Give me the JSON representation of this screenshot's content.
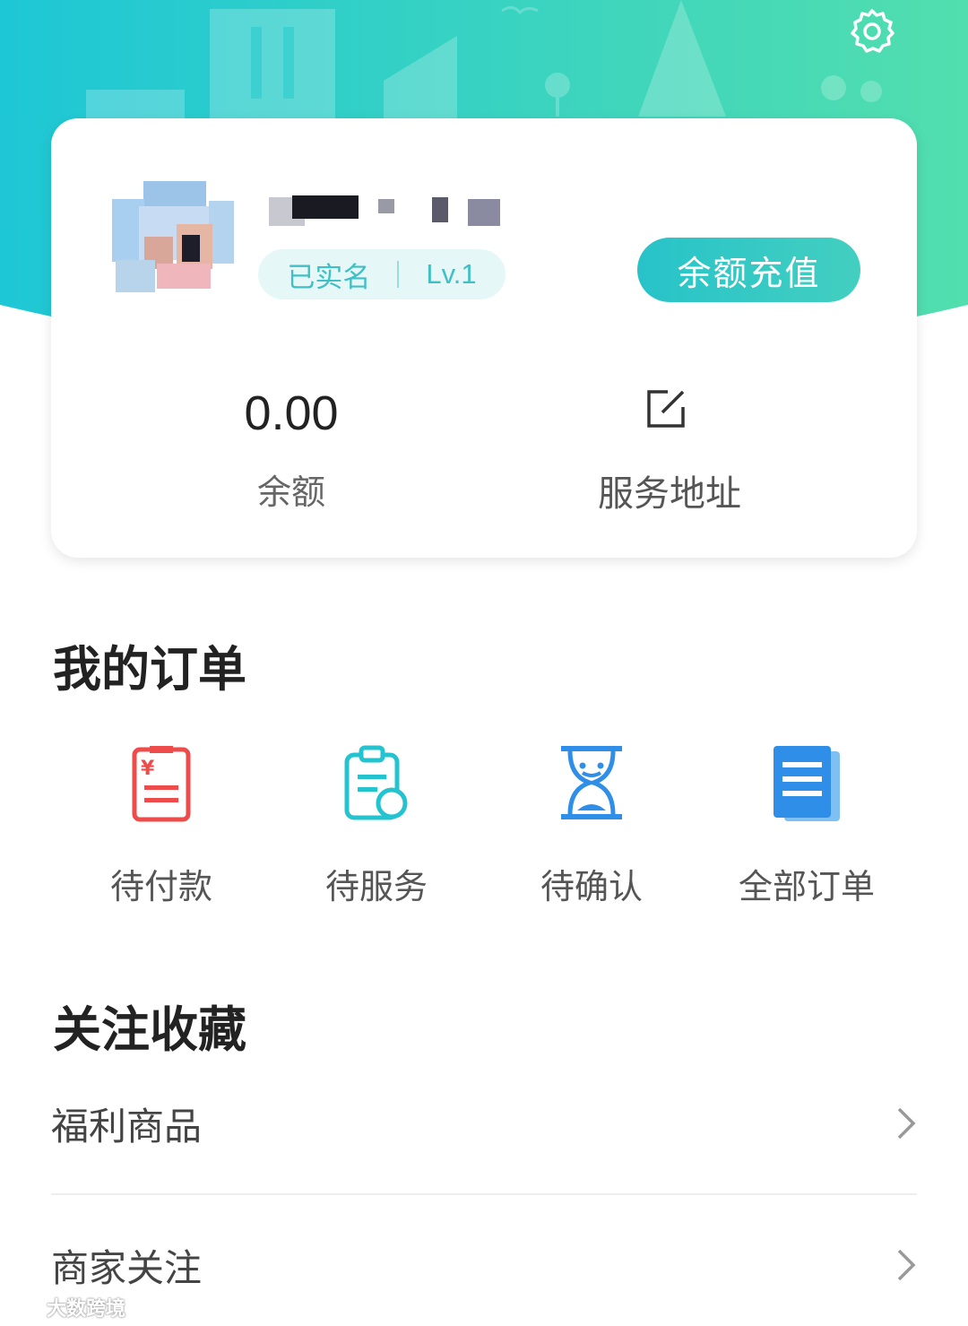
{
  "header": {
    "settings_icon": "gear-icon",
    "gradient_colors": [
      "#1ec7d6",
      "#4fdcb0"
    ]
  },
  "profile": {
    "badge_verified": "已实名",
    "badge_level": "Lv.1",
    "recharge_label": "余额充值",
    "balance_value": "0.00",
    "balance_label": "余额",
    "address_icon": "edit-square-icon",
    "address_label": "服务地址"
  },
  "orders": {
    "title": "我的订单",
    "items": [
      {
        "label": "待付款",
        "icon": "payment-bill-icon",
        "color": "#ee4b4b"
      },
      {
        "label": "待服务",
        "icon": "clipboard-icon",
        "color": "#23c3cf"
      },
      {
        "label": "待确认",
        "icon": "hourglass-icon",
        "color": "#2f8fe8"
      },
      {
        "label": "全部订单",
        "icon": "document-stack-icon",
        "color": "#2f8fe8"
      }
    ]
  },
  "favorites": {
    "title": "关注收藏",
    "rows": [
      {
        "label": "福利商品",
        "icon": "chevron-right-icon"
      },
      {
        "label": "商家关注",
        "icon": "chevron-right-icon"
      }
    ]
  },
  "watermark": {
    "text": "大数跨境"
  }
}
